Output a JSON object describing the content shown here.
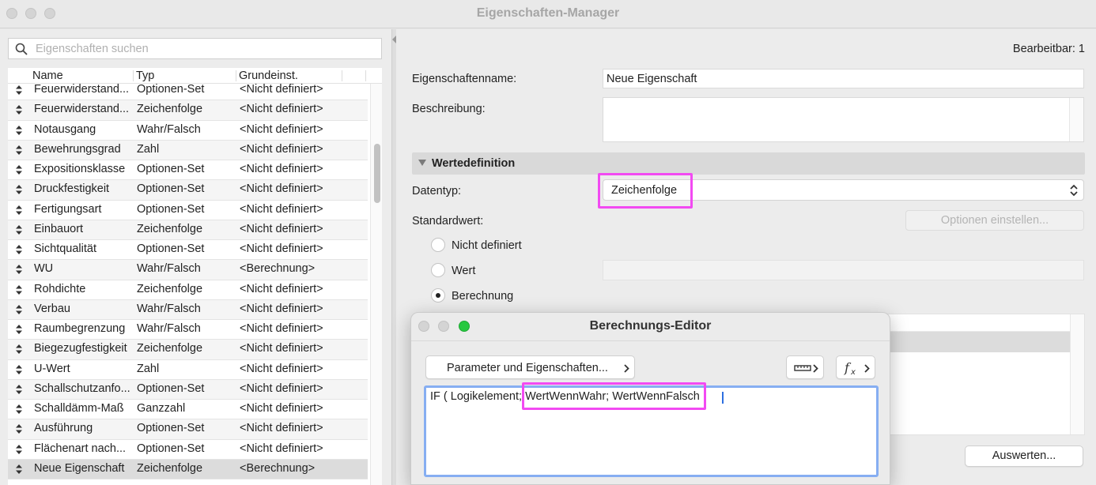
{
  "window": {
    "title": "Eigenschaften-Manager"
  },
  "search": {
    "placeholder": "Eigenschaften suchen"
  },
  "table": {
    "columns": [
      "Name",
      "Typ",
      "Grundeinst."
    ],
    "rows": [
      {
        "name": "Feuerwiderstand...",
        "type": "Optionen-Set",
        "default": "<Nicht definiert>"
      },
      {
        "name": "Feuerwiderstand...",
        "type": "Zeichenfolge",
        "default": "<Nicht definiert>"
      },
      {
        "name": "Notausgang",
        "type": "Wahr/Falsch",
        "default": "<Nicht definiert>"
      },
      {
        "name": "Bewehrungsgrad",
        "type": "Zahl",
        "default": "<Nicht definiert>"
      },
      {
        "name": "Expositionsklasse",
        "type": "Optionen-Set",
        "default": "<Nicht definiert>"
      },
      {
        "name": "Druckfestigkeit",
        "type": "Optionen-Set",
        "default": "<Nicht definiert>"
      },
      {
        "name": "Fertigungsart",
        "type": "Optionen-Set",
        "default": "<Nicht definiert>"
      },
      {
        "name": "Einbauort",
        "type": "Zeichenfolge",
        "default": "<Nicht definiert>"
      },
      {
        "name": "Sichtqualität",
        "type": "Optionen-Set",
        "default": "<Nicht definiert>"
      },
      {
        "name": "WU",
        "type": "Wahr/Falsch",
        "default": "<Berechnung>"
      },
      {
        "name": "Rohdichte",
        "type": "Zeichenfolge",
        "default": "<Nicht definiert>"
      },
      {
        "name": "Verbau",
        "type": "Wahr/Falsch",
        "default": "<Nicht definiert>"
      },
      {
        "name": "Raumbegrenzung",
        "type": "Wahr/Falsch",
        "default": "<Nicht definiert>"
      },
      {
        "name": "Biegezugfestigkeit",
        "type": "Zeichenfolge",
        "default": "<Nicht definiert>"
      },
      {
        "name": "U-Wert",
        "type": "Zahl",
        "default": "<Nicht definiert>"
      },
      {
        "name": "Schallschutzanfo...",
        "type": "Optionen-Set",
        "default": "<Nicht definiert>"
      },
      {
        "name": "Schalldämm-Maß",
        "type": "Ganzzahl",
        "default": "<Nicht definiert>"
      },
      {
        "name": "Ausführung",
        "type": "Optionen-Set",
        "default": "<Nicht definiert>"
      },
      {
        "name": "Flächenart nach...",
        "type": "Optionen-Set",
        "default": "<Nicht definiert>"
      },
      {
        "name": "Neue Eigenschaft",
        "type": "Zeichenfolge",
        "default": "<Berechnung>",
        "selected": true
      }
    ]
  },
  "details": {
    "editable": "Bearbeitbar: 1",
    "name_label": "Eigenschaftenname:",
    "name_value": "Neue Eigenschaft",
    "description_label": "Beschreibung:",
    "section_title": "Wertedefinition",
    "datatype_label": "Datentyp:",
    "datatype_value": "Zeichenfolge",
    "default_label": "Standardwert:",
    "options_button": "Optionen einstellen...",
    "radio_undefined": "Nicht definiert",
    "radio_value": "Wert",
    "radio_calc": "Berechnung",
    "evaluate_button": "Auswerten..."
  },
  "calc_editor": {
    "title": "Berechnungs-Editor",
    "params_button": "Parameter und Eigenschaften...",
    "formula": "IF ( Logikelement; WertWennWahr; WertWennFalsch"
  },
  "colors": {
    "highlight": "#f24af2",
    "focus_ring": "#86aef2",
    "close_light": "#d4d4d4",
    "zoom_light": "#27c840"
  },
  "icons": [
    "search-icon",
    "drag-handle-icon",
    "chevron-updown-icon",
    "ruler-icon",
    "function-icon",
    "chevron-right-icon"
  ]
}
